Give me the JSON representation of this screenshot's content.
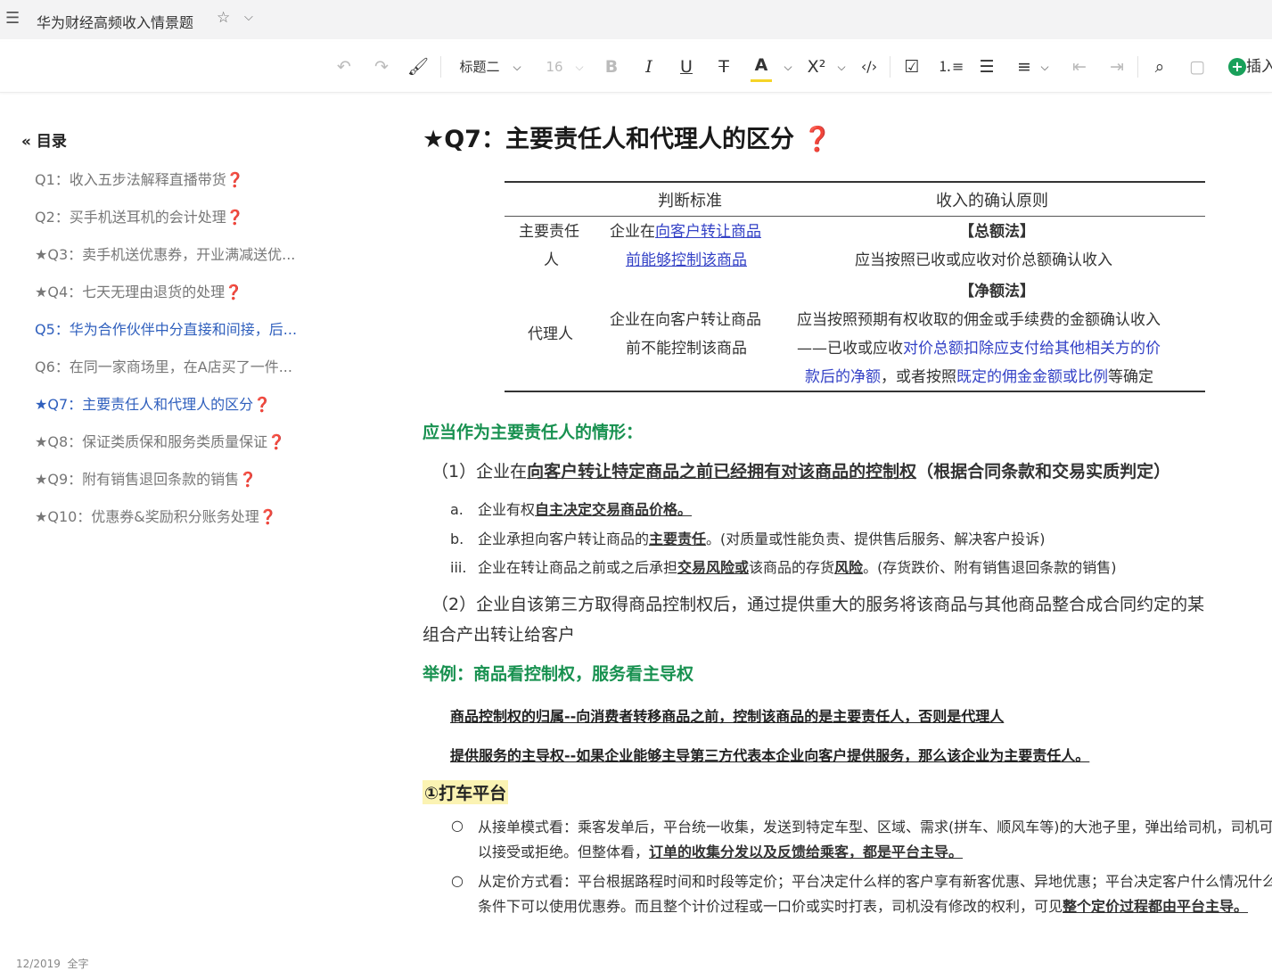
{
  "app": {
    "doc_title": "华为财经高频收入情景题"
  },
  "toolbar": {
    "heading_style": "标题二",
    "font_size": "16",
    "insert_label": "插入"
  },
  "toc": {
    "title": "目录",
    "items": [
      {
        "text": "Q1：收入五步法解释直播带货",
        "q": "❓"
      },
      {
        "text": "Q2：买手机送耳机的会计处理",
        "q": "❓"
      },
      {
        "text": "★Q3：卖手机送优惠券，开业满减送优...",
        "q": ""
      },
      {
        "text": "★Q4：七天无理由退货的处理",
        "q": "❓"
      },
      {
        "text": "Q5：华为合作伙伴中分直接和间接，后...",
        "q": ""
      },
      {
        "text": "Q6：在同一家商场里，在A店买了一件...",
        "q": ""
      },
      {
        "text": "★Q7：主要责任人和代理人的区分",
        "q": "❓"
      },
      {
        "text": "★Q8：保证类质保和服务类质量保证",
        "q": "❓"
      },
      {
        "text": "★Q9：附有销售退回条款的销售",
        "q": "❓"
      },
      {
        "text": "★Q10：优惠券&奖励积分账务处理",
        "q": "❓"
      }
    ],
    "bottom_fragment": "12/2019  全字"
  },
  "content": {
    "heading": "★Q7：主要责任人和代理人的区分",
    "heading_q": "❓",
    "table": {
      "col_criteria": "判断标准",
      "col_principle": "收入的确认原则",
      "row1_role_a": "主要责任",
      "row1_role_b": "人",
      "row1_crit_pre": "企业在",
      "row1_crit_link1": "向客户转让商品",
      "row1_crit_link2": "前能够控制该商品",
      "row1_method": "【总额法】",
      "row1_principle": "应当按照已收或应收对价总额确认收入",
      "row2_method": "【净额法】",
      "row2_role": "代理人",
      "row2_crit_1": "企业在向客户转让商品",
      "row2_crit_2": "前不能控制该商品",
      "row2_p1": "应当按照预期有权收取的佣金或手续费的金额确认收入",
      "row2_p2_pre": "——已收或应收",
      "row2_p2_blue": "对价总额扣除应支付给其他相关方的价",
      "row2_p3_blue1": "款后的净额",
      "row2_p3_mid": "，或者按照",
      "row2_p3_blue2": "既定的佣金金额或比例",
      "row2_p3_end": "等确定"
    },
    "section1_title": "应当作为主要责任人的情形：",
    "p1_pre": "（1）企业在",
    "p1_bold": "向客户转让特定商品之前已经拥有对该商品的控制权",
    "p1_end": "（根据合同条款和交易实质判定）",
    "sub_a_marker": "a.",
    "sub_a_pre": "企业有权",
    "sub_a_bold": "自主决定交易商品价格。",
    "sub_b_marker": "b.",
    "sub_b_pre": "企业承担向客户转让商品的",
    "sub_b_bold": "主要责任",
    "sub_b_end": "。(对质量或性能负责、提供售后服务、解决客户投诉)",
    "sub_c_marker": "iii.",
    "sub_c_pre": "企业在转让商品之前或之后承担",
    "sub_c_bold1": "交易风险或",
    "sub_c_mid": "该商品的存货",
    "sub_c_bold2": "风险",
    "sub_c_end": "。(存货跌价、附有销售退回条款的销售)",
    "p2_line1": "（2）企业自该第三方取得商品控制权后，通过提供重大的服务将该商品与其他商品整合成合同约定的某",
    "p2_line2": "组合产出转让给客户",
    "section2_title": "举例：商品看控制权，服务看主导权",
    "ex1": "商品控制权的归属--向消费者转移商品之前，控制该商品的是主要责任人，否则是代理人",
    "ex2": "提供服务的主导权--如果企业能够主导第三方代表本企业向客户提供服务，那么该企业为主要责任人。",
    "case_title": "①打车平台",
    "b1_marker": "○",
    "b1_text": "从接单模式看：乘客发单后，平台统一收集，发送到特定车型、区域、需求(拼车、顺风车等)的大池子里，弹出给司机，司机可以接受或拒绝。但整体看，",
    "b1_bold": "订单的收集分发以及反馈给乘客，都是平台主导。",
    "b2_marker": "○",
    "b2_text": "从定价方式看：平台根据路程时间和时段等定价；平台决定什么样的客户享有新客优惠、异地优惠；平台决定客户什么情况什么条件下可以使用优惠券。而且整个计价过程或一口价或实时打表，司机没有修改的权利，可见",
    "b2_bold": "整个定价过程都由平台主导。"
  },
  "colors": {
    "accent_blue": "#2f5fbd",
    "link_blue": "#3341c6",
    "green": "#189150",
    "highlight": "#fbf3b3",
    "question_red": "#e0463f"
  }
}
